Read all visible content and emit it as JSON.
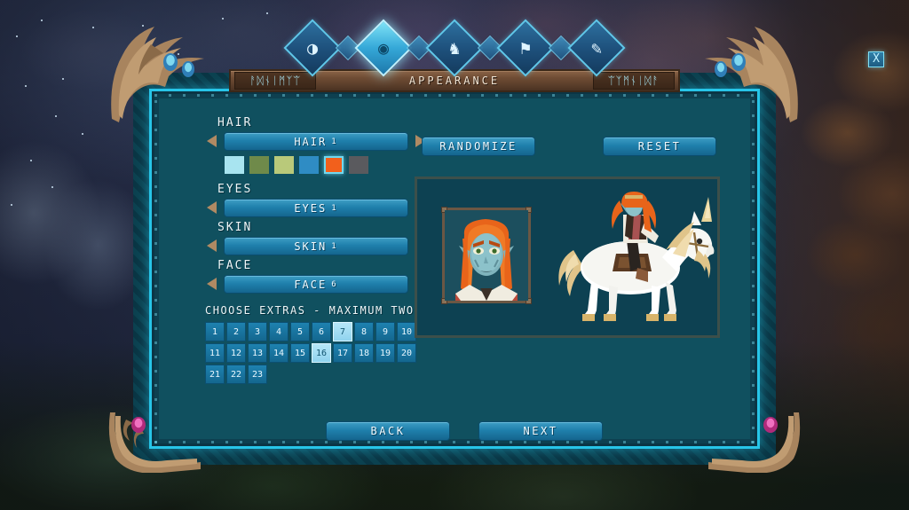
{
  "window": {
    "title": "APPEARANCE",
    "rune_left": "ᚨᛞᚾᛁᛗᛉᛠ",
    "rune_right": "ᛠᛉᛗᚾᛁᛞᚨ",
    "close_label": "X"
  },
  "tabs": [
    {
      "name": "tab-identity",
      "icon": "mask-icon",
      "glyph": "◑",
      "active": false
    },
    {
      "name": "tab-appearance",
      "icon": "eye-icon",
      "glyph": "◉",
      "active": true
    },
    {
      "name": "tab-mount",
      "icon": "horse-icon",
      "glyph": "♞",
      "active": false
    },
    {
      "name": "tab-banner",
      "icon": "banner-icon",
      "glyph": "⚑",
      "active": false
    },
    {
      "name": "tab-scribe",
      "icon": "quill-icon",
      "glyph": "✎",
      "active": false
    }
  ],
  "controls": [
    {
      "label": "HAIR",
      "value": "HAIR",
      "number": "1"
    },
    {
      "label": "EYES",
      "value": "EYES",
      "number": "1"
    },
    {
      "label": "SKIN",
      "value": "SKIN",
      "number": "1"
    },
    {
      "label": "FACE",
      "value": "FACE",
      "number": "6"
    }
  ],
  "hair_colors": [
    {
      "hex": "#a8e4f0",
      "selected": false
    },
    {
      "hex": "#6f8a4a",
      "selected": false
    },
    {
      "hex": "#b9c97a",
      "selected": false
    },
    {
      "hex": "#2f8cc4",
      "selected": false
    },
    {
      "hex": "#f2601c",
      "selected": true
    },
    {
      "hex": "#5a5a5e",
      "selected": false
    }
  ],
  "extras": {
    "title": "CHOOSE EXTRAS - MAXIMUM TWO",
    "cells": [
      {
        "n": "1",
        "selected": false
      },
      {
        "n": "2",
        "selected": false
      },
      {
        "n": "3",
        "selected": false
      },
      {
        "n": "4",
        "selected": false
      },
      {
        "n": "5",
        "selected": false
      },
      {
        "n": "6",
        "selected": false
      },
      {
        "n": "7",
        "selected": true
      },
      {
        "n": "8",
        "selected": false
      },
      {
        "n": "9",
        "selected": false
      },
      {
        "n": "10",
        "selected": false
      },
      {
        "n": "11",
        "selected": false
      },
      {
        "n": "12",
        "selected": false
      },
      {
        "n": "13",
        "selected": false
      },
      {
        "n": "14",
        "selected": false
      },
      {
        "n": "15",
        "selected": false
      },
      {
        "n": "16",
        "selected": true
      },
      {
        "n": "17",
        "selected": false
      },
      {
        "n": "18",
        "selected": false
      },
      {
        "n": "19",
        "selected": false
      },
      {
        "n": "20",
        "selected": false
      },
      {
        "n": "21",
        "selected": false
      },
      {
        "n": "22",
        "selected": false
      },
      {
        "n": "23",
        "selected": false
      }
    ]
  },
  "actions": {
    "randomize": "RANDOMIZE",
    "reset": "RESET",
    "back": "BACK",
    "next": "NEXT"
  },
  "preview": {
    "portrait_alt": "elf-portrait",
    "character_alt": "character-on-unicorn"
  },
  "colors": {
    "panel_bg": "#10505f",
    "panel_border": "#27c5e8",
    "button_blue": "#1f80ac",
    "accent_cyan": "#7fe3f7",
    "wood": "#6f4c34"
  }
}
